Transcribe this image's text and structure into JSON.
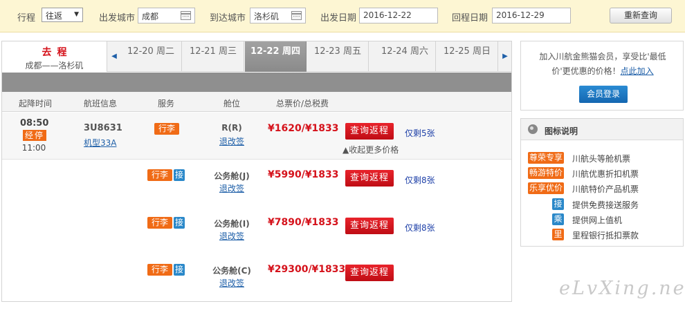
{
  "search": {
    "trip_label": "行程",
    "trip_value": "往返",
    "from_label": "出发城市",
    "from_value": "成都",
    "to_label": "到达城市",
    "to_value": "洛杉矶",
    "depart_label": "出发日期",
    "depart_value": "2016-12-22",
    "return_label": "回程日期",
    "return_value": "2016-12-29",
    "requery": "重新查询"
  },
  "trip": {
    "title": "去程",
    "route": "成都——洛杉矶"
  },
  "dates": [
    {
      "label": "12-20 周二"
    },
    {
      "label": "12-21 周三"
    },
    {
      "label": "12-22 周四"
    },
    {
      "label": "12-23 周五"
    },
    {
      "label": "12-24 周六"
    },
    {
      "label": "12-25 周日"
    }
  ],
  "headers": {
    "time": "起降时间",
    "flight": "航班信息",
    "service": "服务",
    "cabin": "舱位",
    "price": "总票价/总税费"
  },
  "flight": {
    "depart": "08:50",
    "stop": "经停",
    "arrive": "11:00",
    "number": "3U8631",
    "aircraft": "机型33A",
    "collapse": "▲收起更多价格"
  },
  "fares": [
    {
      "luggage": "行李",
      "pickup": "",
      "cabin": "R(R)",
      "change": "退改签",
      "price": "¥1620/¥1833",
      "query": "查询返程",
      "remain": "仅剩5张"
    },
    {
      "luggage": "行李",
      "pickup": "接",
      "cabin": "公务舱(J)",
      "change": "退改签",
      "price": "¥5990/¥1833",
      "query": "查询返程",
      "remain": "仅剩8张"
    },
    {
      "luggage": "行李",
      "pickup": "接",
      "cabin": "公务舱(I)",
      "change": "退改签",
      "price": "¥7890/¥1833",
      "query": "查询返程",
      "remain": "仅剩8张"
    },
    {
      "luggage": "行李",
      "pickup": "接",
      "cabin": "公务舱(C)",
      "change": "退改签",
      "price": "¥29300/¥1833",
      "query": "查询返程",
      "remain": ""
    }
  ],
  "member": {
    "text1": "加入川航金熊猫会员，享受比'最低",
    "text2": "价'更优惠的价格！",
    "link": "点此加入",
    "login": "会员登录"
  },
  "legend": {
    "title": "图标说明",
    "items": [
      {
        "tag": "尊荣专享",
        "text": "川航头等舱机票"
      },
      {
        "tag": "畅游特价",
        "text": "川航优惠折扣机票"
      },
      {
        "tag": "乐享优价",
        "text": "川航特价产品机票"
      },
      {
        "tag": "接",
        "text": "提供免费接送服务"
      },
      {
        "tag": "乘",
        "text": "提供网上值机"
      },
      {
        "tag": "里",
        "text": "里程银行抵扣票款"
      }
    ]
  },
  "watermark": "eLvXing.net",
  "colors": {
    "accent_red": "#d5121b",
    "badge_orange": "#f06b16",
    "badge_blue": "#2a88c9",
    "link_blue": "#1e5fa8",
    "search_bg": "#fdf6d3"
  },
  "icons": {
    "calendar": "calendar-icon",
    "prev": "arrow-left-icon",
    "next": "arrow-right-icon",
    "legend": "legend-icon"
  }
}
